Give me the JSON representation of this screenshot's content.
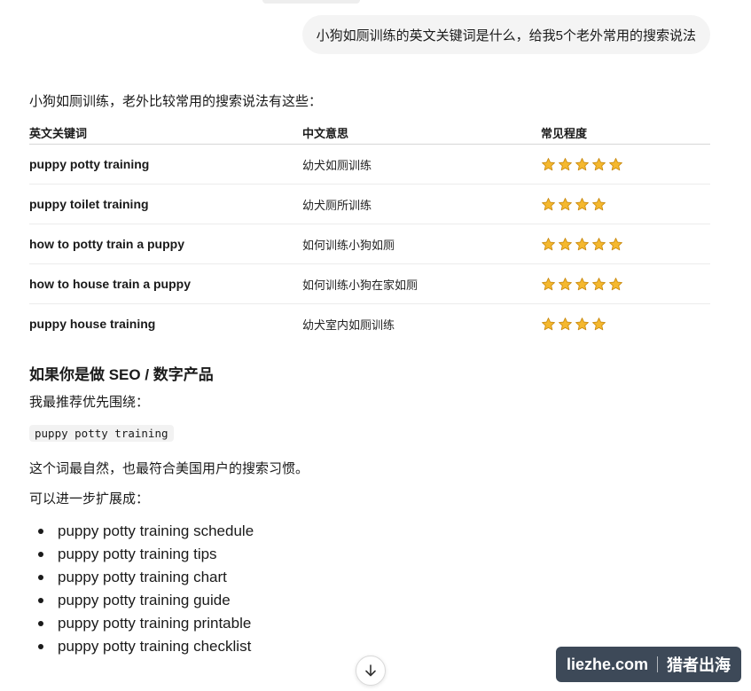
{
  "user_message": "小狗如厕训练的英文关键词是什么，给我5个老外常用的搜索说法",
  "reply": {
    "intro": "小狗如厕训练，老外比较常用的搜索说法有这些：",
    "table": {
      "headers": [
        "英文关键词",
        "中文意思",
        "常见程度"
      ],
      "rows": [
        {
          "en": "puppy potty training",
          "cn": "幼犬如厕训练",
          "stars": 5
        },
        {
          "en": "puppy toilet training",
          "cn": "幼犬厕所训练",
          "stars": 4
        },
        {
          "en": "how to potty train a puppy",
          "cn": "如何训练小狗如厕",
          "stars": 5
        },
        {
          "en": "how to house train a puppy",
          "cn": "如何训练小狗在家如厕",
          "stars": 5
        },
        {
          "en": "puppy house training",
          "cn": "幼犬室内如厕训练",
          "stars": 4
        }
      ],
      "star_color": "#f5b82e"
    },
    "section_title": "如果你是做 SEO / 数字产品",
    "recommend_text": "我最推荐优先围绕：",
    "recommend_code": "puppy potty training",
    "reason_text": "这个词最自然，也最符合美国用户的搜索习惯。",
    "expand_text": "可以进一步扩展成：",
    "expand_list": [
      "puppy potty training schedule",
      "puppy potty training tips",
      "puppy potty training chart",
      "puppy potty training guide",
      "puppy potty training printable",
      "puppy potty training checklist"
    ]
  },
  "scroll_button": {
    "icon": "arrow-down-icon"
  },
  "watermark": {
    "site": "liezhe.com",
    "brand": "猎者出海"
  }
}
